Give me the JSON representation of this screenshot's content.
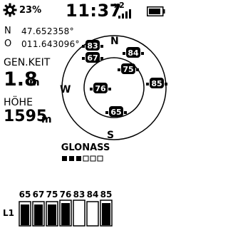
{
  "status_bar": {
    "battery_percent": "23%",
    "time": "11:37",
    "sat_count": "x2",
    "icons": [
      "gear-icon",
      "signal-bars-icon",
      "battery-icon"
    ]
  },
  "position": {
    "lat_prefix": "N",
    "lat_value": "47.652358°",
    "lon_prefix": "O",
    "lon_value": "011.643096°"
  },
  "speed": {
    "label": "GEN.KEIT",
    "value": "1.8",
    "unit": "m"
  },
  "altitude": {
    "label": "HÖHE",
    "value": "1595",
    "unit": "m"
  },
  "sky_plot": {
    "directions": {
      "north": "N",
      "south": "S",
      "west": "W"
    },
    "satellites": [
      {
        "id": "83",
        "style": "filled"
      },
      {
        "id": "67",
        "style": "filled"
      },
      {
        "id": "84",
        "style": "filled"
      },
      {
        "id": "75",
        "style": "filled"
      },
      {
        "id": "76",
        "style": "filled"
      },
      {
        "id": "85",
        "style": "filled"
      },
      {
        "id": "65",
        "style": "filled"
      }
    ]
  },
  "constellation": {
    "name": "GLONASS",
    "pages_total": 6,
    "page_active": 3
  },
  "signals": {
    "band": "L1",
    "bars": [
      {
        "id": "65",
        "strength": 0.86,
        "filled": true
      },
      {
        "id": "67",
        "strength": 0.86,
        "filled": true
      },
      {
        "id": "75",
        "strength": 0.86,
        "filled": true
      },
      {
        "id": "76",
        "strength": 0.9,
        "filled": true
      },
      {
        "id": "83",
        "strength": 0.9,
        "filled": false
      },
      {
        "id": "84",
        "strength": 0.86,
        "filled": false
      },
      {
        "id": "85",
        "strength": 0.9,
        "filled": true
      }
    ]
  },
  "colors": {
    "foreground": "#000000",
    "background": "#ffffff"
  }
}
